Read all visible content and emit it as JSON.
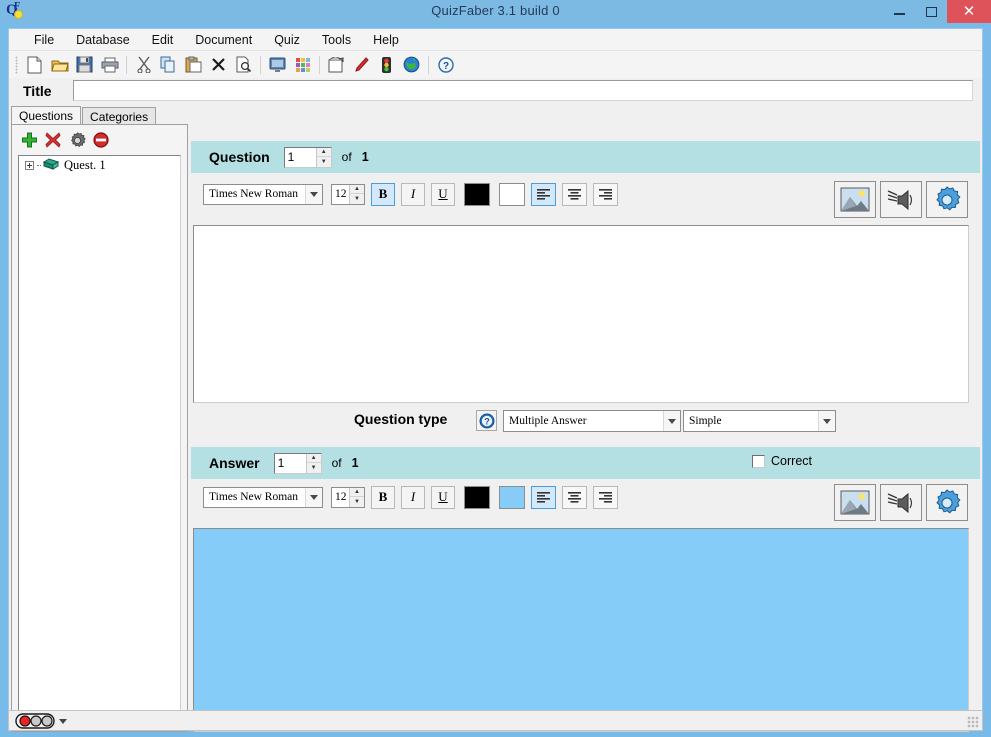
{
  "window": {
    "title": "QuizFaber 3.1 build 0",
    "app_icon": "quizfaber-logo-icon",
    "minimize_label": "–",
    "maximize_label": "□",
    "close_label": "×",
    "close_color": "#dd5359",
    "titlebar_color": "#7cbae4"
  },
  "menubar": {
    "items": [
      {
        "label": "File"
      },
      {
        "label": "Database"
      },
      {
        "label": "Edit"
      },
      {
        "label": "Document"
      },
      {
        "label": "Quiz"
      },
      {
        "label": "Tools"
      },
      {
        "label": "Help"
      }
    ]
  },
  "toolbar": {
    "buttons": [
      {
        "icon": "new-document-icon",
        "tooltip": "New"
      },
      {
        "icon": "open-folder-icon",
        "tooltip": "Open"
      },
      {
        "icon": "save-disk-icon",
        "tooltip": "Save"
      },
      {
        "icon": "print-icon",
        "tooltip": "Print"
      },
      {
        "icon": "cut-scissors-icon",
        "tooltip": "Cut"
      },
      {
        "icon": "copy-icon",
        "tooltip": "Copy"
      },
      {
        "icon": "paste-clipboard-icon",
        "tooltip": "Paste"
      },
      {
        "icon": "delete-x-icon",
        "tooltip": "Delete"
      },
      {
        "icon": "print-preview-icon",
        "tooltip": "Preview"
      },
      {
        "icon": "monitor-icon",
        "tooltip": "Display"
      },
      {
        "icon": "color-grid-icon",
        "tooltip": "Colors"
      },
      {
        "icon": "template-house-icon",
        "tooltip": "Template"
      },
      {
        "icon": "red-pencil-icon",
        "tooltip": "Edit"
      },
      {
        "icon": "traffic-light-icon",
        "tooltip": "Status"
      },
      {
        "icon": "globe-icon",
        "tooltip": "Web"
      },
      {
        "icon": "help-question-icon",
        "tooltip": "Help"
      }
    ]
  },
  "title_row": {
    "label": "Title",
    "value": "",
    "placeholder": ""
  },
  "sidebar": {
    "tabs": [
      {
        "label": "Questions",
        "active": true
      },
      {
        "label": "Categories",
        "active": false
      }
    ],
    "tools": [
      {
        "icon": "add-plus-icon",
        "tooltip": "Add question"
      },
      {
        "icon": "delete-x-icon",
        "tooltip": "Delete question"
      },
      {
        "icon": "gear-icon",
        "tooltip": "Properties"
      },
      {
        "icon": "forbidden-icon",
        "tooltip": "Disable"
      }
    ],
    "tree": [
      {
        "label": "Quest. 1",
        "icon": "book-icon",
        "expandable": true
      }
    ]
  },
  "question_section": {
    "header_label": "Question",
    "index_value": "1",
    "of_label": "of",
    "total": "1",
    "format_toolbar": {
      "font_name": "Times New Roman",
      "font_size": "12",
      "bold_label": "B",
      "italic_label": "I",
      "underline_label": "U",
      "bold_active": true,
      "italic_active": false,
      "underline_active": false,
      "fore_color": "#000000",
      "back_color": "#ffffff",
      "align_left_active": true,
      "align_center_active": false,
      "align_right_active": false,
      "buttons": [
        {
          "icon": "insert-image-icon",
          "tooltip": "Insert image"
        },
        {
          "icon": "insert-sound-icon",
          "tooltip": "Insert sound"
        },
        {
          "icon": "settings-gear-icon",
          "tooltip": "Settings"
        }
      ]
    },
    "editor_text": "",
    "editor_background": "#ffffff"
  },
  "question_type": {
    "label": "Question type",
    "help_icon": "help-question-icon",
    "type_value": "Multiple Answer",
    "mode_value": "Simple"
  },
  "answer_section": {
    "header_label": "Answer",
    "index_value": "1",
    "of_label": "of",
    "total": "1",
    "correct_label": "Correct",
    "correct_checked": false,
    "format_toolbar": {
      "font_name": "Times New Roman",
      "font_size": "12",
      "bold_label": "B",
      "italic_label": "I",
      "underline_label": "U",
      "bold_active": false,
      "italic_active": false,
      "underline_active": false,
      "fore_color": "#000000",
      "back_color": "#86ccf8",
      "align_left_active": true,
      "align_center_active": false,
      "align_right_active": false,
      "buttons": [
        {
          "icon": "insert-image-icon",
          "tooltip": "Insert image"
        },
        {
          "icon": "insert-sound-icon",
          "tooltip": "Insert sound"
        },
        {
          "icon": "settings-gear-icon",
          "tooltip": "Settings"
        }
      ]
    },
    "editor_text": "",
    "editor_background": "#86ccf8"
  },
  "statusbar": {
    "traffic_light": {
      "icon": "traffic-light-icon",
      "lit": "red",
      "lights": [
        "#ee2222",
        "#c9c9c9",
        "#c9c9c9"
      ]
    },
    "message": ""
  },
  "colors": {
    "header_bar": "#b4e0e4",
    "answer_editor": "#86ccf8",
    "window_chrome": "#78bbe8",
    "panel": "#f0f0f0"
  }
}
